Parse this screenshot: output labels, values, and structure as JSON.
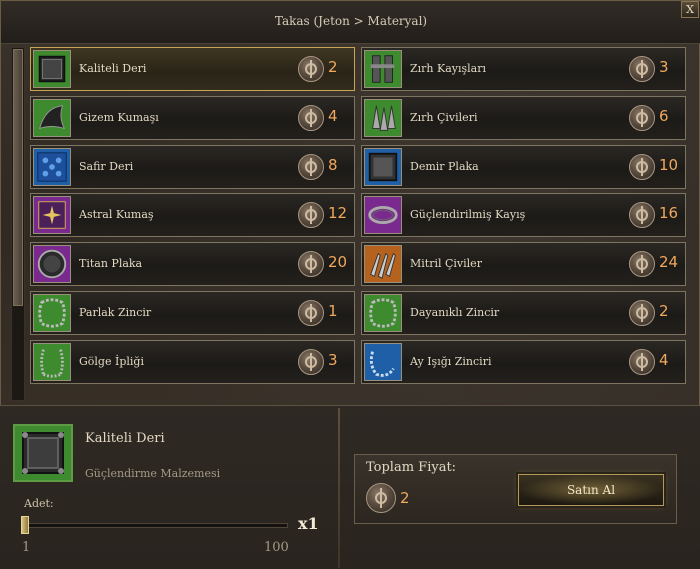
{
  "window": {
    "title": "Takas (Jeton > Materyal)",
    "close_label": "X"
  },
  "items": [
    {
      "name": "Kaliteli Deri",
      "price": "2",
      "selected": true,
      "rarity_color": "#3e8a2e"
    },
    {
      "name": "Zırh Kayışları",
      "price": "3",
      "rarity_color": "#3e8a2e"
    },
    {
      "name": "Gizem Kumaşı",
      "price": "4",
      "rarity_color": "#3e8a2e"
    },
    {
      "name": "Zırh Çivileri",
      "price": "6",
      "rarity_color": "#3e8a2e"
    },
    {
      "name": "Safir Deri",
      "price": "8",
      "rarity_color": "#1f5fa8"
    },
    {
      "name": "Demir Plaka",
      "price": "10",
      "rarity_color": "#1f5fa8"
    },
    {
      "name": "Astral Kumaş",
      "price": "12",
      "rarity_color": "#7a2a8e"
    },
    {
      "name": "Güçlendirilmiş Kayış",
      "price": "16",
      "rarity_color": "#7a2a8e"
    },
    {
      "name": "Titan Plaka",
      "price": "20",
      "rarity_color": "#7a2a8e"
    },
    {
      "name": "Mitril Çiviler",
      "price": "24",
      "rarity_color": "#b5621e"
    },
    {
      "name": "Parlak Zincir",
      "price": "1",
      "rarity_color": "#3e8a2e"
    },
    {
      "name": "Dayanıklı Zincir",
      "price": "2",
      "rarity_color": "#3e8a2e"
    },
    {
      "name": "Gölge İpliği",
      "price": "3",
      "rarity_color": "#3e8a2e"
    },
    {
      "name": "Ay Işığı Zinciri",
      "price": "4",
      "rarity_color": "#1f5fa8"
    }
  ],
  "item_icons": [
    "leather-icon",
    "straps-icon",
    "cloth-icon",
    "spikes-icon",
    "sapphire-leather-icon",
    "iron-plate-icon",
    "astral-cloth-icon",
    "reinforced-strap-icon",
    "titan-plate-icon",
    "mithril-spikes-icon",
    "chain-icon",
    "chain-icon",
    "thread-icon",
    "moonlight-chain-icon"
  ],
  "selection": {
    "name": "Kaliteli Deri",
    "category": "Güçlendirme Malzemesi",
    "quantity_label": "Adet:",
    "quantity_display": "x1",
    "slider_min": "1",
    "slider_max": "100",
    "slider_value": 1
  },
  "total": {
    "label": "Toplam Fiyat:",
    "price": "2",
    "buy_label": "Satın Al"
  }
}
